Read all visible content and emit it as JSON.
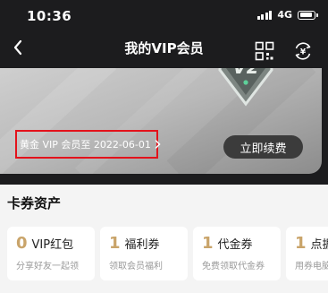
{
  "status_bar": {
    "time": "10:36",
    "network": "4G"
  },
  "header": {
    "title": "我的VIP会员"
  },
  "vip_card": {
    "badge": "V2",
    "expiry_text": "黄金 VIP 会员至 2022-06-01",
    "renew_label": "立即续费"
  },
  "assets": {
    "title": "卡券资产",
    "items": [
      {
        "count": "0",
        "name": "VIP红包",
        "desc": "分享好友一起领"
      },
      {
        "count": "1",
        "name": "福利券",
        "desc": "领取会员福利"
      },
      {
        "count": "1",
        "name": "代金券",
        "desc": "免费领取代金券"
      },
      {
        "count": "1",
        "name": "点据",
        "desc": "用券电脑"
      }
    ]
  },
  "colors": {
    "accent_gold": "#c9a46a",
    "highlight_red": "#e3121b",
    "header_bg": "#1c1c1e"
  },
  "icons": {
    "back": "chevron-left-icon",
    "qr": "qr-code-icon",
    "exchange": "currency-exchange-icon",
    "expiry_arrow": "chevron-right-icon"
  }
}
